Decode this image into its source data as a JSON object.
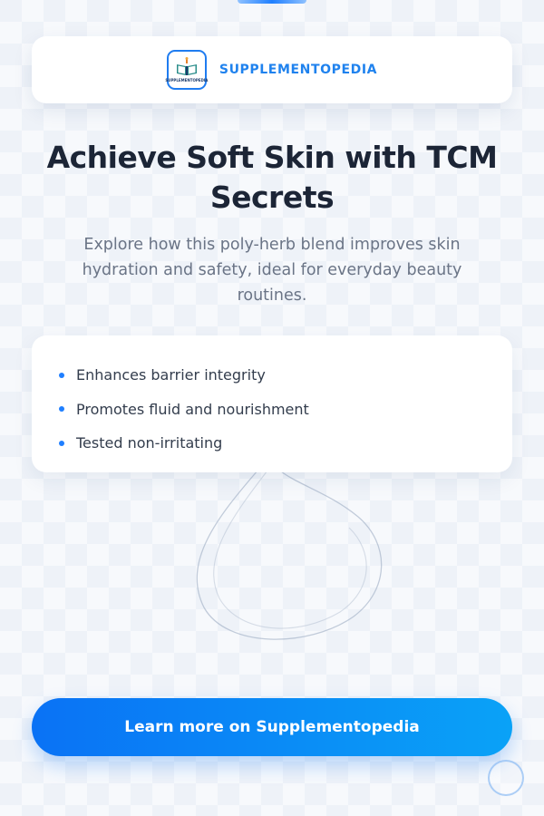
{
  "brand": {
    "name": "SUPPLEMENTOPEDIA",
    "logo_text": "SUPPLEMENTOPEDIA",
    "accent_color": "#1f82ee"
  },
  "hero": {
    "title": "Achieve Soft Skin with TCM Secrets",
    "subtitle": "Explore how this poly-herb blend improves skin hydration and safety, ideal for everyday beauty routines."
  },
  "features": {
    "items": [
      {
        "label": "Enhances barrier integrity"
      },
      {
        "label": "Promotes fluid and nourishment"
      },
      {
        "label": "Tested non-irritating"
      }
    ],
    "bullet_icon": "dot-icon",
    "bullet_color": "#1f7fff"
  },
  "cta": {
    "label": "Learn more on Supplementopedia",
    "gradient_start": "#0a72f5",
    "gradient_end": "#0aa2f7"
  },
  "decor": {
    "background_icon": "swirl-icon",
    "floating_icon": "circle-icon"
  }
}
